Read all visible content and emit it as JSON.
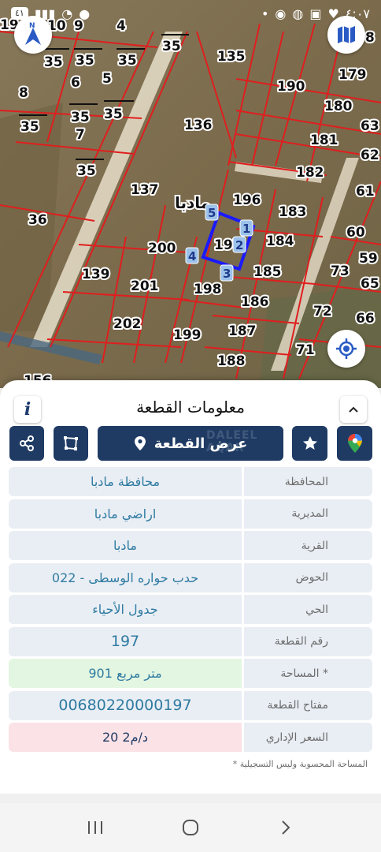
{
  "status_bar": {
    "time": "٤:٠٧",
    "battery": "٤١"
  },
  "map": {
    "region_label": "مادبا",
    "parcels": [
      "19",
      "10",
      "9",
      "4",
      "8",
      "35",
      "35",
      "35",
      "35",
      "135",
      "179",
      "6",
      "5",
      "190",
      "180",
      "8",
      "35",
      "35",
      "136",
      "63",
      "35",
      "7",
      "181",
      "62",
      "35",
      "182",
      "61",
      "137",
      "196",
      "183",
      "36",
      "60",
      "200",
      "197",
      "184",
      "59",
      "139",
      "201",
      "185",
      "73",
      "65",
      "198",
      "186",
      "72",
      "202",
      "66",
      "199",
      "187",
      "71",
      "188",
      "156"
    ],
    "vertices": [
      "1",
      "2",
      "3",
      "4",
      "5"
    ]
  },
  "panel": {
    "title": "معلومات القطعة",
    "view_button": "عرض القطعة",
    "watermark": "DALEEL AQAR",
    "rows": [
      {
        "label": "المحافظة",
        "value": "محافظة مادبا"
      },
      {
        "label": "المديرية",
        "value": "اراضي مادبا"
      },
      {
        "label": "القرية",
        "value": "مادبا"
      },
      {
        "label": "الحوض",
        "value": "حدب حواره الوسطى - 022"
      },
      {
        "label": "الحي",
        "value": "جدول الأحياء"
      },
      {
        "label": "رقم القطعة",
        "value": "197"
      },
      {
        "label": "المساحة *",
        "value": "901   متر مربع"
      },
      {
        "label": "مفتاح القطعة",
        "value": "00680220000197"
      },
      {
        "label": "السعر الإداري",
        "value": "20 د/م2"
      }
    ],
    "footnote": "* المساحة المحسوبة وليس التسجيلية"
  },
  "colors": {
    "primary": "#1f3b64",
    "value_text": "#2f7ba2",
    "parcel_line": "#e01e1e",
    "selected_line": "#1a1aff"
  },
  "icons": {
    "compass": "compass-icon",
    "layers": "map-layers-icon",
    "locate": "locate-icon",
    "share": "share-icon",
    "polygon": "polygon-icon",
    "pin": "pin-icon",
    "star": "star-icon",
    "gmaps": "google-maps-icon"
  }
}
